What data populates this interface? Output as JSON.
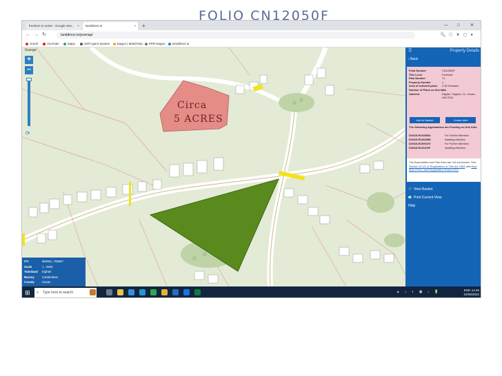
{
  "handwritten_title": "FOLIO CN12050F",
  "browser": {
    "tabs": [
      {
        "label": "freehere to sente - Google Sea..."
      },
      {
        "label": "landdirect.ie"
      }
    ],
    "url": "landdirect.ie/pramap/",
    "bookmarks": [
      "Gmail",
      "YouTube",
      "Maps",
      "Self-Agent System",
      "Eagon | Mailchimp",
      "PPR Eagon",
      "landdirect.ie"
    ],
    "window_controls": {
      "minimize": "—",
      "maximize": "□",
      "close": "✕"
    }
  },
  "map": {
    "geoportal_label": "Goerge",
    "zoom_in": "+",
    "zoom_out": "−",
    "annotation_lines": [
      "Circa",
      "5 ACRES"
    ],
    "colors": {
      "background": "#e3ead6",
      "pink_parcel": "#e58c87",
      "green_parcel": "#5a8a1e",
      "yellow_marker": "#f1e31e"
    }
  },
  "info_box": {
    "rows": [
      {
        "key": "ITV",
        "value": "650061, 785687"
      },
      {
        "key": "Scale",
        "value": "1 : 2500"
      },
      {
        "key": "Townland",
        "value": "Eighter"
      },
      {
        "key": "Barony",
        "value": "Castlerahan"
      },
      {
        "key": "County",
        "value": "Cavan"
      }
    ]
  },
  "panel": {
    "menu_icon": "☰",
    "title": "Property Details",
    "back_label": "Back",
    "property": [
      {
        "key": "Folio Number",
        "value": "CN12050F"
      },
      {
        "key": "Title Level",
        "value": "Freehold"
      },
      {
        "key": "Plan Number",
        "value": "71"
      },
      {
        "key": "Property Number",
        "value": "1"
      },
      {
        "key": "Area of selected plans",
        "value": "2.26 Hectares"
      },
      {
        "key": "Number of Plans on this folio",
        "value": "1"
      },
      {
        "key": "Address",
        "value": "Eighter, Virginia, Co. Cavan, A82 R111"
      }
    ],
    "add_to_basket": "Add to Basket",
    "create_alert": "Create Alert",
    "pending_title": "The following Applications are Pending on this folio",
    "applications": [
      {
        "id": "D2022LR134006U",
        "status": "For Further Attention"
      },
      {
        "id": "D2022LR148448D",
        "status": "Awaiting Attention"
      },
      {
        "id": "D2022LR150047X",
        "status": "For Further Attention"
      },
      {
        "id": "D2022LR141103F",
        "status": "Awaiting Attention"
      }
    ],
    "note_text": "The Boundaries and Plan Area are not conclusive. See",
    "note_link_1": "Section 62 (2) of Registration of Title Act 1964",
    "note_and": "and",
    "note_link_2": "Rule 8(3) of the Land Registration Rules 2012",
    "actions": [
      {
        "icon": "🛒",
        "label": "View Basket"
      },
      {
        "icon": "🖶",
        "label": "Print Current View"
      },
      {
        "icon": "",
        "label": "Help"
      }
    ]
  },
  "taskbar": {
    "search_placeholder": "Type here to search",
    "tray_lang": "ENG",
    "time": "14:45",
    "date": "22/08/2022"
  }
}
